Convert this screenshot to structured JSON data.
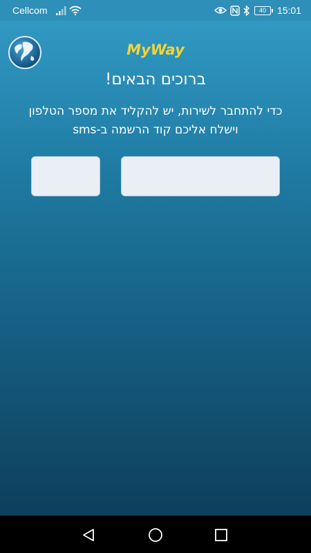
{
  "status_bar": {
    "carrier": "Cellcom",
    "battery_level": "40",
    "time": "15:01"
  },
  "app": {
    "title": "MyWay",
    "welcome": "ברוכים הבאים!",
    "instructions": "כדי להתחבר לשירות, יש להקליד את מספר הטלפון וישלח אליכם קוד הרשמה ב-sms"
  },
  "phone_form": {
    "prefix_value": "",
    "number_value": ""
  },
  "colors": {
    "status_bar": "#2e8fb8",
    "title_yellow": "#f2d43a",
    "field_bg": "#e9eff4",
    "gradient_top": "#3199c3",
    "gradient_bottom": "#0e3f5b"
  },
  "icons": {
    "signal": "signal-bars-icon",
    "wifi": "wifi-icon",
    "eye": "eye-icon",
    "nfc": "nfc-icon",
    "bluetooth": "bluetooth-icon",
    "globe": "globe-icon",
    "back": "back-triangle-icon",
    "home": "home-circle-icon",
    "recents": "recents-square-icon"
  }
}
